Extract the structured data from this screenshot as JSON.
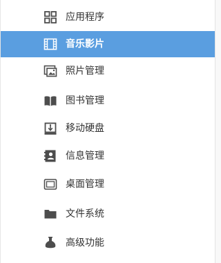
{
  "theme": {
    "accent": "#5a9ee0",
    "icon_color": "#4d4d4d",
    "active_text": "#ffffff",
    "text": "#333333"
  },
  "menu": {
    "items": [
      {
        "label": "应用程序",
        "icon": "apps-grid-icon",
        "active": false
      },
      {
        "label": "音乐影片",
        "icon": "film-icon",
        "active": true
      },
      {
        "label": "照片管理",
        "icon": "photo-icon",
        "active": false
      },
      {
        "label": "图书管理",
        "icon": "book-icon",
        "active": false
      },
      {
        "label": "移动硬盘",
        "icon": "usb-drive-icon",
        "active": false
      },
      {
        "label": "信息管理",
        "icon": "contact-card-icon",
        "active": false
      },
      {
        "label": "桌面管理",
        "icon": "monitor-icon",
        "active": false
      },
      {
        "label": "文件系统",
        "icon": "folder-icon",
        "active": false
      },
      {
        "label": "高级功能",
        "icon": "flask-icon",
        "active": false
      }
    ]
  }
}
